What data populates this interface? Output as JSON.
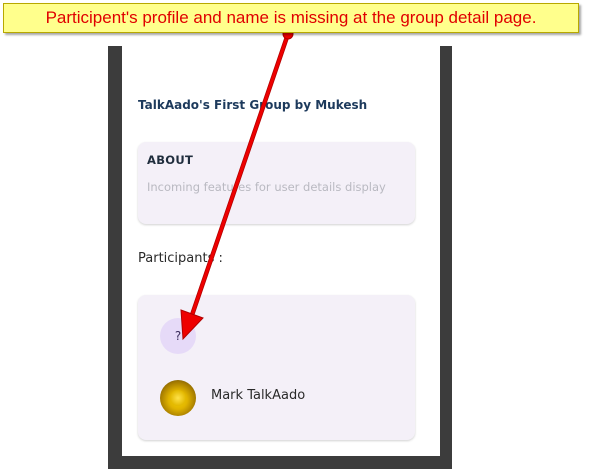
{
  "annotation": {
    "text": "Participent's profile and name is missing at the group detail page.",
    "color": "#e00000",
    "background": "#ffff8c"
  },
  "group": {
    "title": "TalkAado's First Group by Mukesh"
  },
  "about": {
    "title": "ABOUT",
    "text": "Incoming features for user details display"
  },
  "participants": {
    "label": "Participants :",
    "items": [
      {
        "avatar_text": "?",
        "name": ""
      },
      {
        "avatar_text": "",
        "name": "Mark TalkAado"
      }
    ]
  },
  "colors": {
    "title_blue": "#1d3a5c",
    "card_bg": "#f4f0f8",
    "placeholder_avatar": "#e6daf8",
    "frame": "#3c3c3c"
  }
}
